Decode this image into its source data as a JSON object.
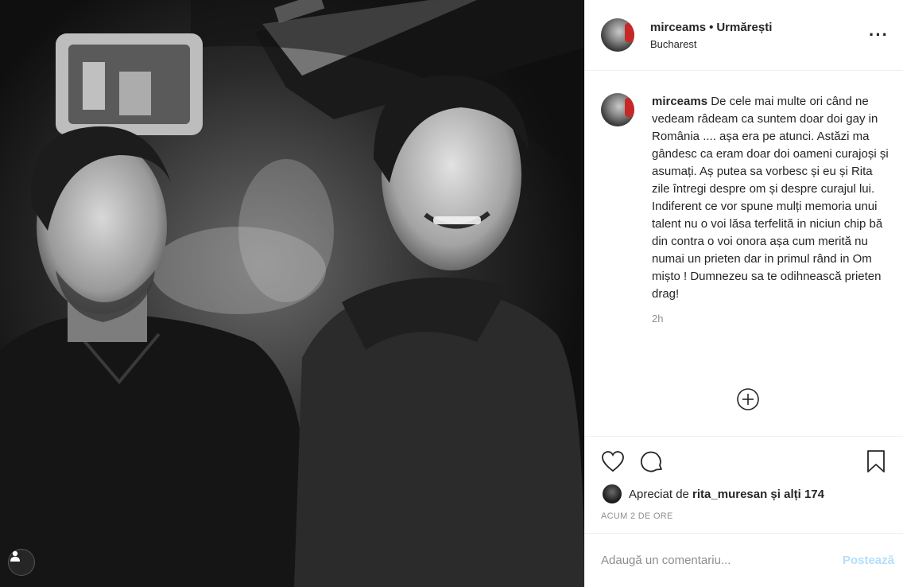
{
  "post": {
    "username": "mirceams",
    "follow_status": "Urmărești",
    "location": "Bucharest",
    "caption": "De cele mai multe ori când ne vedeam râdeam ca suntem doar doi gay in România .... așa era pe atunci. Astăzi ma gândesc ca eram doar doi oameni curajoși și asumați. Aș putea sa vorbesc și eu și Rita zile întregi despre om și despre curajul lui. Indiferent ce vor spune mulți memoria unui talent nu o voi lăsa terfelită in niciun chip bă din contra o voi onora așa cum merită nu numai un prieten dar in primul rând in Om mișto ! Dumnezeu sa te odihnească prieten drag!",
    "caption_time": "2h"
  },
  "likes": {
    "prefix": "Apreciat de ",
    "liker": "rita_muresan",
    "suffix": " și alți 174"
  },
  "time_ago": "ACUM 2 DE ORE",
  "comment": {
    "placeholder": "Adaugă un comentariu...",
    "post_label": "Postează"
  },
  "icons": {
    "more": "more-options-icon",
    "like": "heart-icon",
    "comment": "comment-icon",
    "save": "bookmark-icon",
    "load_more": "plus-circle-icon",
    "tags": "user-tag-icon"
  }
}
